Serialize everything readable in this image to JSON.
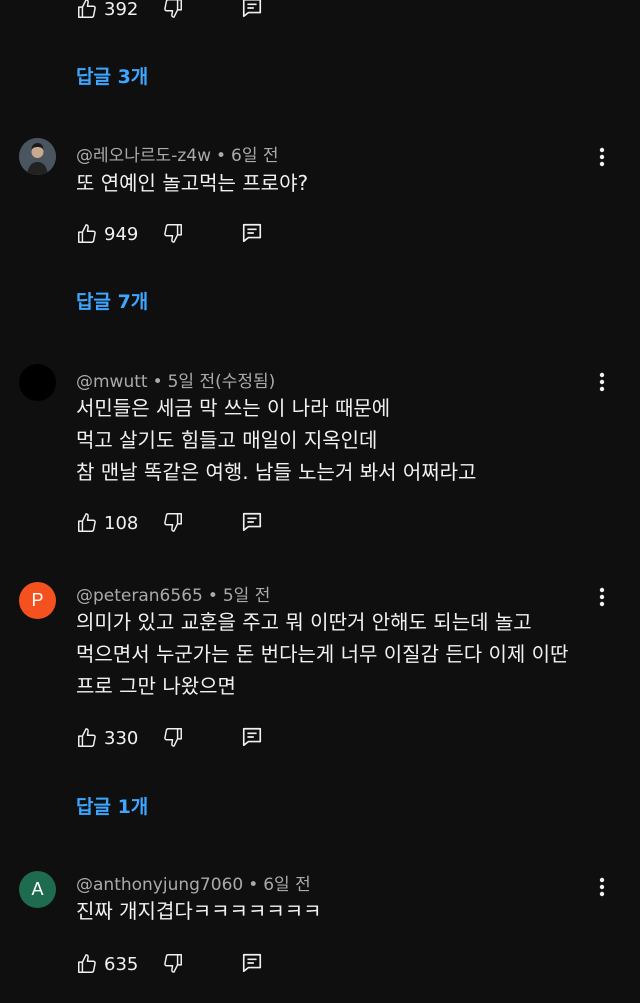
{
  "comments_top": {
    "prev_like_count": "392",
    "prev_replies_label": "답글 3개"
  },
  "comments": [
    {
      "author": "@레오나르도-z4w",
      "time": "6일 전",
      "lines": [
        "또 연예인 놀고먹는 프로야?"
      ],
      "likes": "949",
      "replies_label": "답글 7개",
      "avatar_letter": "",
      "avatar_color": "#3a3f44"
    },
    {
      "author": "@mwutt",
      "time": "5일 전(수정됨)",
      "lines": [
        "서민들은 세금 막 쓰는 이 나라 때문에",
        "먹고 살기도 힘들고 매일이 지옥인데",
        "참 맨날 똑같은 여행. 남들 노는거 봐서 어쩌라고"
      ],
      "likes": "108",
      "replies_label": "",
      "avatar_letter": "",
      "avatar_color": "#000000"
    },
    {
      "author": "@peteran6565",
      "time": "5일 전",
      "lines": [
        "의미가 있고 교훈을 주고 뭐 이딴거 안해도 되는데 놀고",
        "먹으면서 누군가는 돈 번다는게 너무 이질감 든다 이제 이딴",
        "프로 그만 나왔으면"
      ],
      "likes": "330",
      "replies_label": "답글 1개",
      "avatar_letter": "P",
      "avatar_color": "#f4511e"
    },
    {
      "author": "@anthonyjung7060",
      "time": "6일 전",
      "lines": [
        "진짜 개지겹다ㅋㅋㅋㅋㅋㅋㅋ"
      ],
      "likes": "635",
      "replies_label": "",
      "avatar_letter": "A",
      "avatar_color": "#1e6b4f"
    }
  ],
  "icons": {
    "like": "thumb-up-icon",
    "dislike": "thumb-down-icon",
    "reply": "comment-reply-icon",
    "more": "more-vert-icon"
  },
  "colors": {
    "background": "#0f0f0f",
    "link": "#3ea6ff",
    "meta": "#aaaaaa",
    "text": "#f1f1f1"
  }
}
